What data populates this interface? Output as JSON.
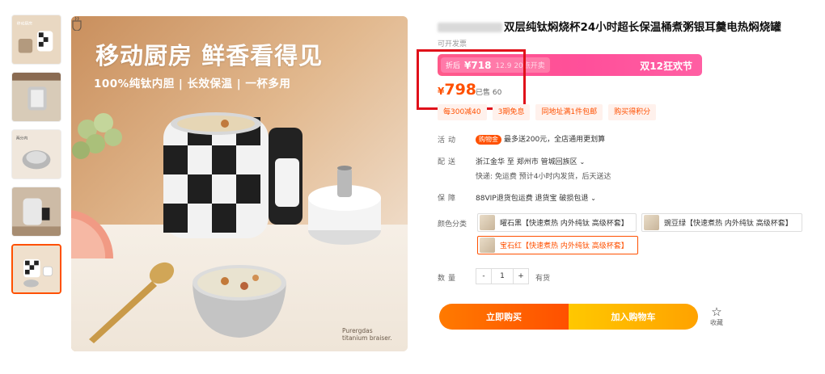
{
  "image": {
    "hero_title": "移动厨房 鲜香看得见",
    "hero_subtitle": "100%纯钛内胆 | 长效保温 | 一杯多用",
    "brand_line1": "Purergdas",
    "brand_line2": "titanium braiser."
  },
  "product": {
    "title": "双层纯钛焖烧杯24小时超长保温桶煮粥银耳羹电热焖烧罐",
    "invoice_note": "可开发票"
  },
  "promo": {
    "label": "折后",
    "price": "¥718",
    "date": "12.9 20点开卖",
    "event": "双12狂欢节"
  },
  "price": {
    "currency": "¥",
    "value": "798",
    "sold": "已售 60"
  },
  "coupons": [
    "每300减40",
    "3期免息",
    "同地址满1件包邮",
    "购买得积分"
  ],
  "rows": {
    "activity_label": "活动",
    "activity_tag": "购物金",
    "activity_text": "最多送200元，全店通用更划算",
    "delivery_label": "配送",
    "delivery_route": "浙江金华 至 郑州市 管城回族区",
    "delivery_detail": "快递: 免运费  预计4小时内发货，后天送达",
    "guarantee_label": "保障",
    "guarantee_text": "88VIP退货包运费 退货宝 破损包退",
    "color_label": "颜色分类",
    "quantity_label": "数量"
  },
  "skus": [
    "曜石黑【快速煮热 内外纯钛 高级杯套】",
    "豌豆绿【快速煮热 内外纯钛 高级杯套】",
    "宝石红【快速煮热 内外纯钛 高级杯套】"
  ],
  "quantity": {
    "minus": "-",
    "value": "1",
    "plus": "+",
    "stock": "有货"
  },
  "actions": {
    "buy": "立即购买",
    "cart": "加入购物车",
    "favorite": "收藏"
  },
  "colors": {
    "accent": "#ff5000",
    "promo_pink": "#ff4f9a",
    "highlight_red": "#e0101a",
    "cart_yellow": "#ffa200"
  }
}
